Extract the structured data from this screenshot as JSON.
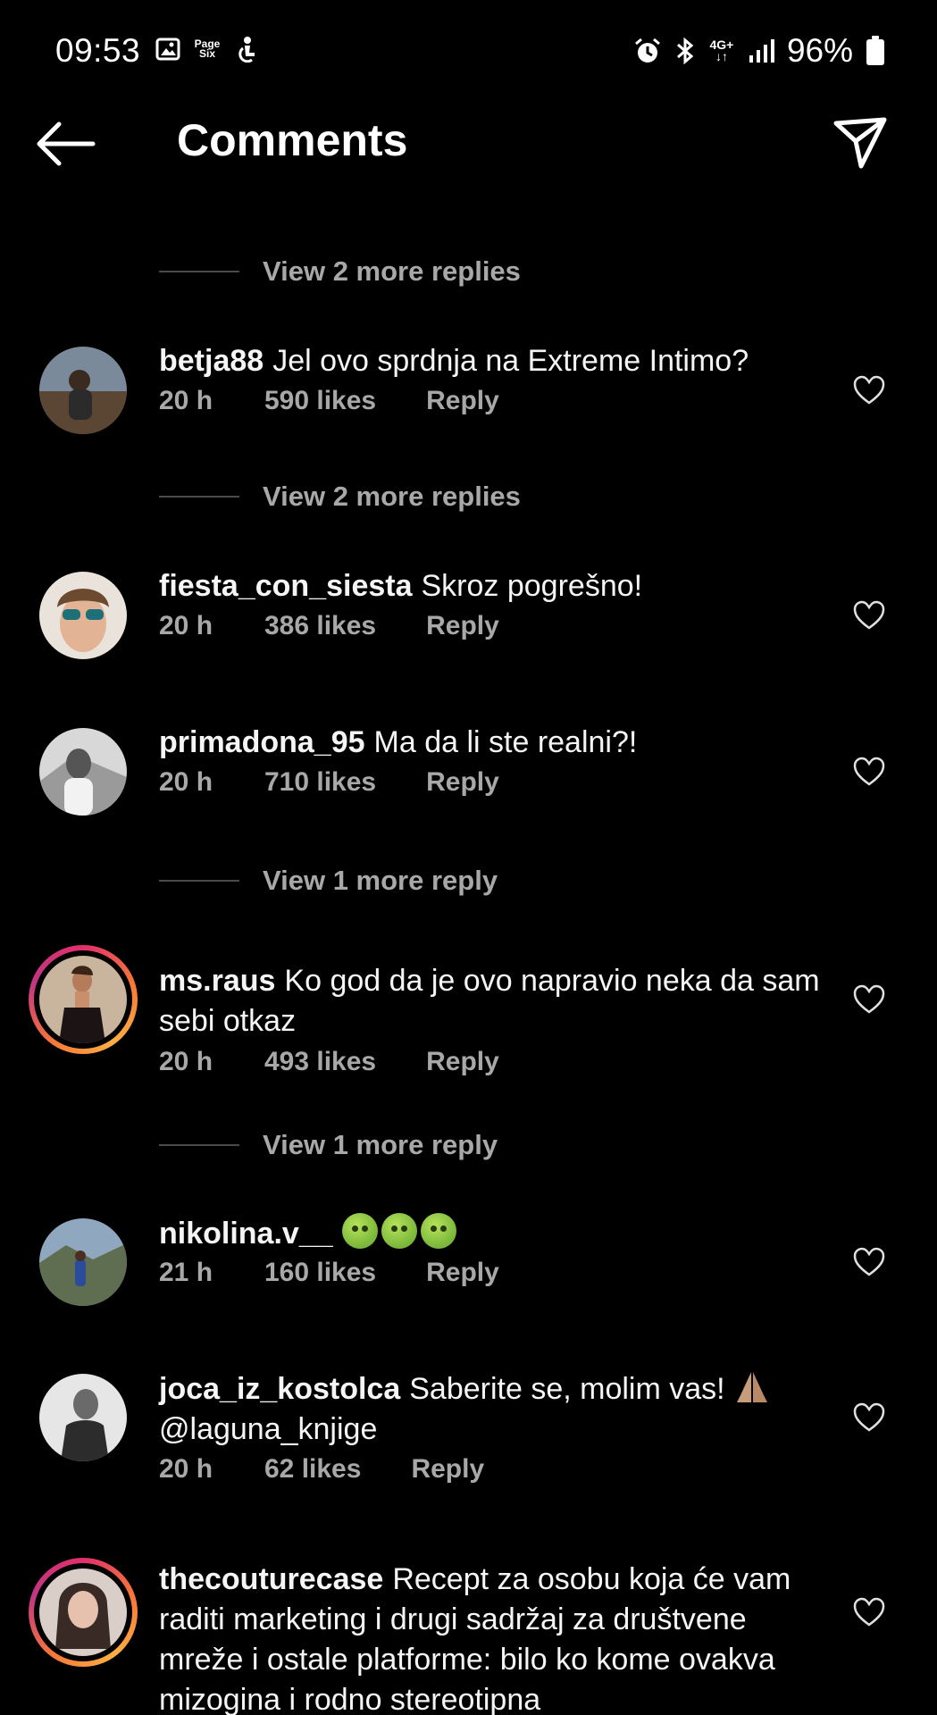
{
  "status_bar": {
    "time": "09:53",
    "battery": "96%",
    "notif_badge": "Page\nSix",
    "network": "4G+"
  },
  "header": {
    "title": "Comments"
  },
  "comments": [
    {
      "username": "betja88",
      "text": "Jel ovo sprdnja na Extreme Intimo?",
      "time": "20 h",
      "likes": "590 likes",
      "reply": "Reply"
    },
    {
      "username": "fiesta_con_siesta",
      "text": "Skroz pogrešno!",
      "time": "20 h",
      "likes": "386 likes",
      "reply": "Reply"
    },
    {
      "username": "primadona_95",
      "text": "Ma da li ste realni?!",
      "time": "20 h",
      "likes": "710 likes",
      "reply": "Reply"
    },
    {
      "username": "ms.raus",
      "text": "Ko god da je ovo napravio neka da sam sebi otkaz",
      "time": "20 h",
      "likes": "493 likes",
      "reply": "Reply"
    },
    {
      "username": "nikolina.v__",
      "text": "",
      "time": "21 h",
      "likes": "160 likes",
      "reply": "Reply"
    },
    {
      "username": "joca_iz_kostolca",
      "text": "Saberite se, molim vas!",
      "mention": "@laguna_knjige",
      "time": "20 h",
      "likes": "62 likes",
      "reply": "Reply"
    },
    {
      "username": "thecouturecase",
      "text": "Recept za osobu koja će vam raditi marketing i drugi sadržaj za društvene mreže i ostale platforme: bilo ko kome ovakva mizogina i rodno stereotipna"
    }
  ],
  "view_replies": [
    "View 2 more replies",
    "View 2 more replies",
    "View 1 more reply",
    "View 1 more reply"
  ]
}
